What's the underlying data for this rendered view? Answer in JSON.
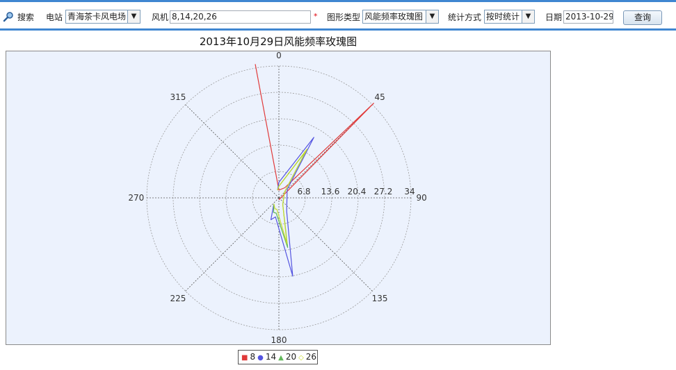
{
  "toolbar": {
    "search_label": "搜索",
    "station_label": "电站",
    "station_value": "青海茶卡风电场",
    "turbine_label": "风机",
    "turbine_value": "8,14,20,26",
    "required_mark": "*",
    "chart_type_label": "图形类型",
    "chart_type_value": "风能频率玫瑰图",
    "stat_label": "统计方式",
    "stat_value": "按时统计",
    "date_label": "日期",
    "date_value": "2013-10-29",
    "query_label": "查询"
  },
  "colors": {
    "accent": "#3f86d1",
    "plot_bg": "#ecf2fd"
  },
  "chart_data": {
    "type": "polar-rose",
    "title": "2013年10月29日风能频率玫瑰图",
    "angle_labels": [
      "0",
      "45",
      "90",
      "135",
      "180",
      "225",
      "270",
      "315"
    ],
    "radial_labels": [
      "6.8",
      "13.6",
      "20.4",
      "27.2",
      "34"
    ],
    "rmax": 34,
    "grid": true,
    "legend_position": "bottom-center",
    "series": [
      {
        "name": "8",
        "color": "#e03a3a",
        "marker": "square",
        "points": [
          [
            -10,
            35
          ],
          [
            0,
            2
          ],
          [
            30,
            3
          ],
          [
            45,
            34.5
          ],
          [
            180,
            0.5
          ]
        ]
      },
      {
        "name": "14",
        "color": "#5454e0",
        "marker": "circle",
        "points": [
          [
            -10,
            2
          ],
          [
            0,
            4
          ],
          [
            30,
            18
          ],
          [
            45,
            3
          ],
          [
            150,
            4
          ],
          [
            170,
            20.5
          ],
          [
            190,
            5
          ],
          [
            200,
            6
          ],
          [
            220,
            2
          ]
        ]
      },
      {
        "name": "20",
        "color": "#62b85a",
        "marker": "triangle",
        "points": [
          [
            -10,
            2
          ],
          [
            0,
            3
          ],
          [
            30,
            14
          ],
          [
            45,
            2
          ],
          [
            150,
            2
          ],
          [
            170,
            13
          ],
          [
            190,
            4
          ],
          [
            200,
            4
          ],
          [
            220,
            2
          ]
        ]
      },
      {
        "name": "26",
        "color": "#c8dc2c",
        "marker": "diamond",
        "points": [
          [
            -10,
            2
          ],
          [
            0,
            3
          ],
          [
            30,
            14.5
          ],
          [
            45,
            2
          ],
          [
            150,
            2
          ],
          [
            170,
            12
          ],
          [
            190,
            3
          ],
          [
            200,
            3
          ],
          [
            220,
            2
          ]
        ]
      }
    ]
  }
}
